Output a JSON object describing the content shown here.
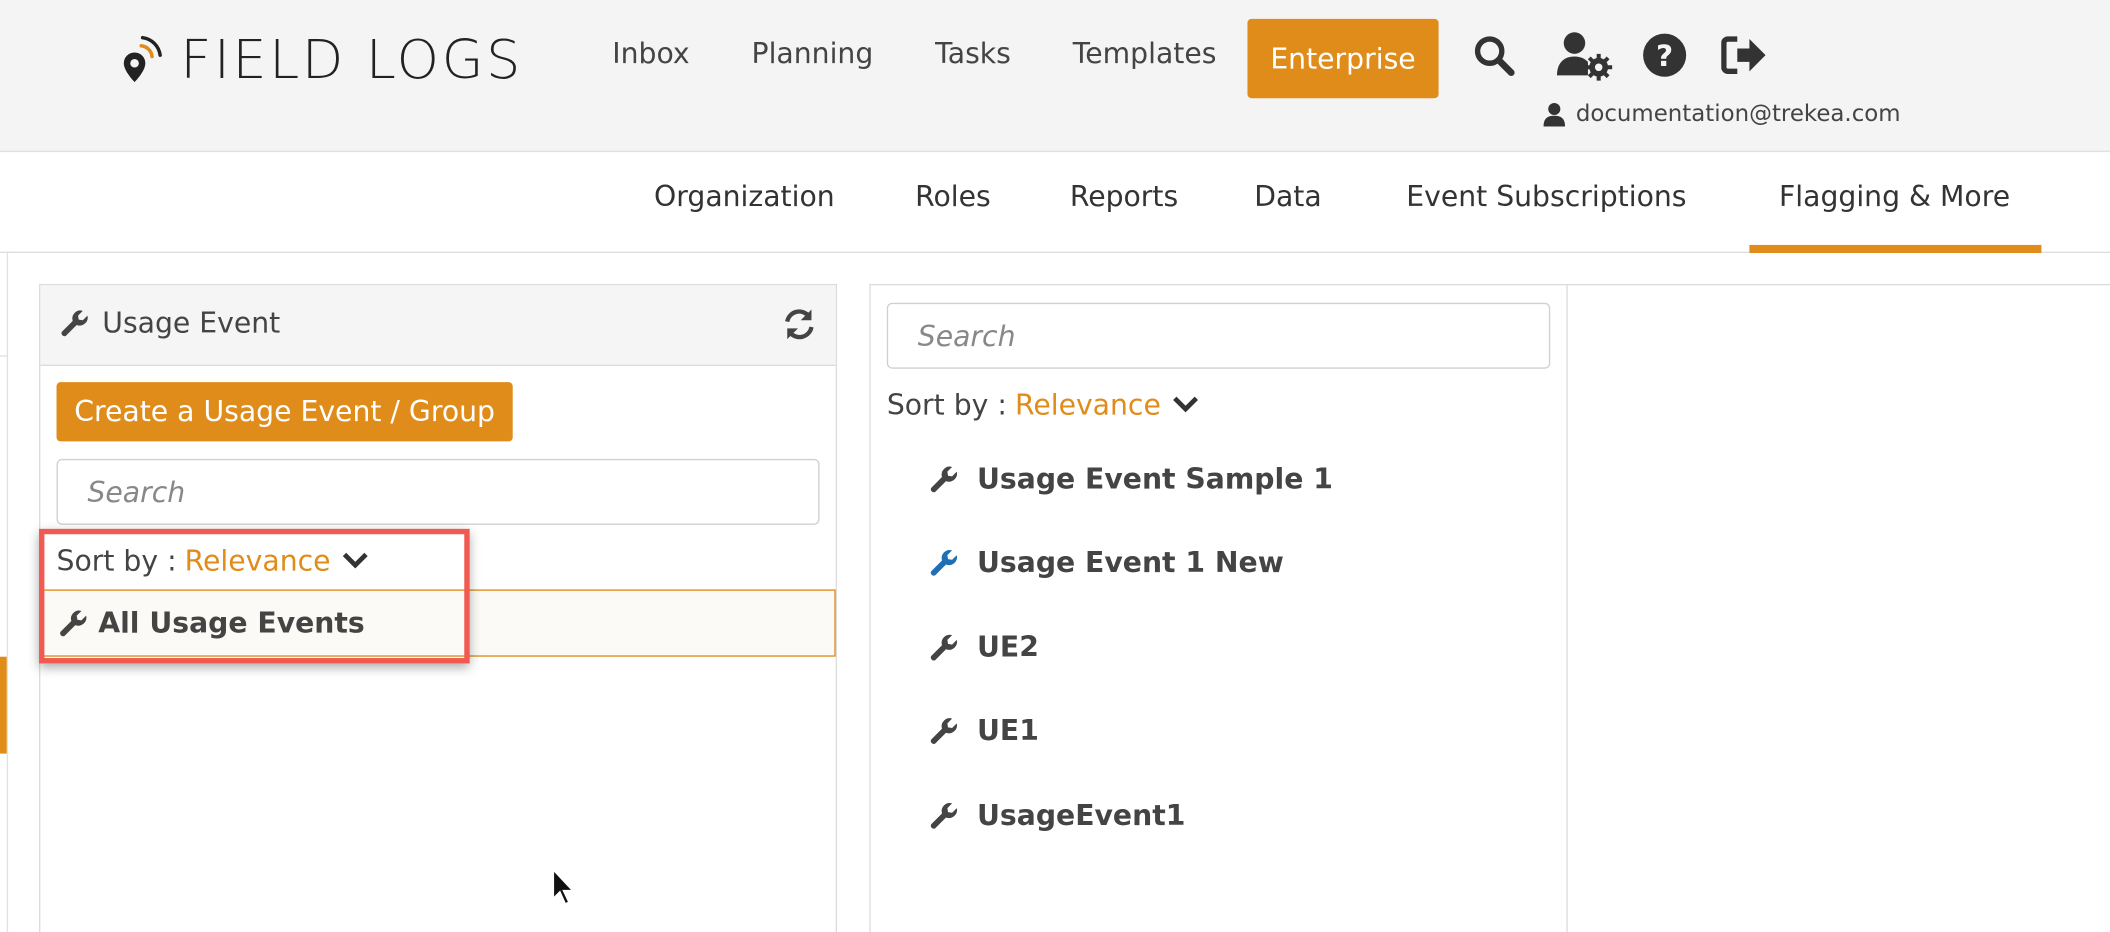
{
  "header": {
    "logo_text": "FIELD LOGS",
    "nav": [
      "Inbox",
      "Planning",
      "Tasks",
      "Templates"
    ],
    "enterprise_label": "Enterprise",
    "icons": [
      "search-icon",
      "user-settings-icon",
      "help-icon",
      "sign-out-icon"
    ],
    "user_email": "documentation@trekea.com"
  },
  "subnav": {
    "items": [
      "Organization",
      "Roles",
      "Reports",
      "Data",
      "Event Subscriptions",
      "Flagging & More"
    ],
    "active": "Flagging & More"
  },
  "left_panel": {
    "title": "Usage Event",
    "create_button": "Create a Usage Event / Group",
    "search_placeholder": "Search",
    "sort_label": "Sort by :",
    "sort_value": "Relevance",
    "all_item": "All Usage Events"
  },
  "right_panel": {
    "search_placeholder": "Search",
    "sort_label": "Sort by :",
    "sort_value": "Relevance",
    "items": [
      {
        "label": "Usage Event Sample 1",
        "icon_color": "#444444"
      },
      {
        "label": "Usage Event 1 New",
        "icon_color": "#1f6fb5"
      },
      {
        "label": "UE2",
        "icon_color": "#444444"
      },
      {
        "label": "UE1",
        "icon_color": "#444444"
      },
      {
        "label": "UsageEvent1",
        "icon_color": "#444444"
      }
    ]
  },
  "colors": {
    "accent": "#e08c1a",
    "highlight": "#f05a50",
    "blue_icon": "#1f6fb5"
  }
}
